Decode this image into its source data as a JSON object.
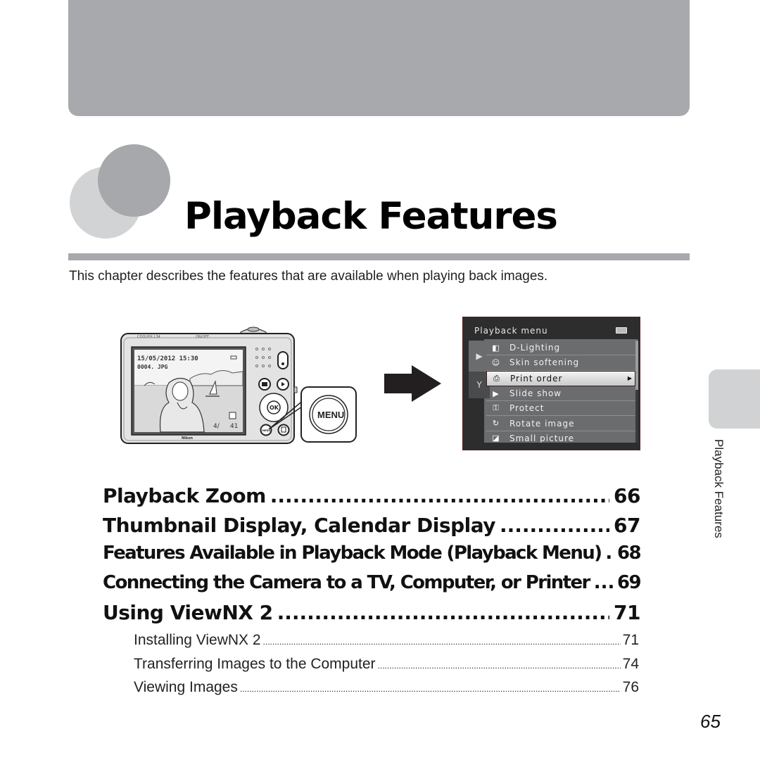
{
  "chapter": {
    "title": "Playback Features",
    "intro": "This chapter describes the features that are available when playing back images."
  },
  "illustration": {
    "camera": {
      "model_label": "COOLPIX L34",
      "power_label": "ON/OFF",
      "brand": "Nikon",
      "screen_date": "15/05/2012  15:30",
      "screen_file": "0004. JPG",
      "screen_counter_left": "4/",
      "screen_counter_right": "41",
      "ok_label": "OK",
      "menu_small_label": "MENU",
      "callout_label": "MENU"
    },
    "menu_screen": {
      "title": "Playback menu",
      "tabs": [
        {
          "name": "playback-tab",
          "icon": "▶"
        },
        {
          "name": "setup-tab",
          "icon": "Y"
        }
      ],
      "items": [
        {
          "label": "D-Lighting",
          "icon": "d-lighting-icon",
          "glyph": "◧"
        },
        {
          "label": "Skin softening",
          "icon": "skin-softening-icon",
          "glyph": "☺"
        },
        {
          "label": "Print order",
          "icon": "print-order-icon",
          "glyph": "⎙",
          "selected": true
        },
        {
          "label": "Slide show",
          "icon": "slide-show-icon",
          "glyph": "▶"
        },
        {
          "label": "Protect",
          "icon": "protect-key-icon",
          "glyph": "⚿"
        },
        {
          "label": "Rotate image",
          "icon": "rotate-image-icon",
          "glyph": "↻"
        },
        {
          "label": "Small picture",
          "icon": "small-picture-icon",
          "glyph": "◪"
        }
      ]
    }
  },
  "toc": {
    "major": [
      {
        "title": "Playback Zoom",
        "page": "66"
      },
      {
        "title": "Thumbnail Display, Calendar Display",
        "page": "67"
      },
      {
        "title": "Features Available in Playback Mode (Playback Menu)",
        "page": "68"
      },
      {
        "title": "Connecting the Camera to a TV, Computer, or Printer",
        "page": "69"
      },
      {
        "title": "Using ViewNX 2",
        "page": "71"
      }
    ],
    "minor": [
      {
        "title": "Installing ViewNX 2",
        "page": "71"
      },
      {
        "title": "Transferring Images to the Computer",
        "page": "74"
      },
      {
        "title": "Viewing Images",
        "page": "76"
      }
    ]
  },
  "side_tab": {
    "label": "Playback Features"
  },
  "page_number": "65",
  "colors": {
    "banner": "#a8a9ad",
    "circle_light": "#d2d3d5",
    "circle_dark": "#a7a8ab",
    "menu_bg": "#2d2d2e",
    "menu_panel": "#6b6c6e"
  }
}
